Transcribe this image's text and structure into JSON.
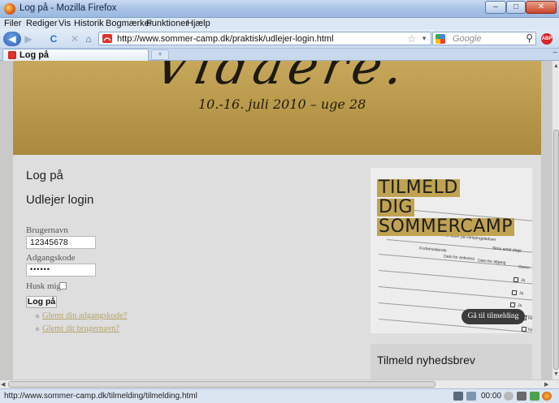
{
  "window": {
    "title": "Log på - Mozilla Firefox",
    "min_glyph": "–",
    "max_glyph": "□",
    "close_glyph": "✕"
  },
  "menu": [
    "Filer",
    "Rediger",
    "Vis",
    "Historik",
    "Bogmærker",
    "Funktioner",
    "Hjælp"
  ],
  "toolbar": {
    "back_glyph": "◀",
    "forward_glyph": "▶",
    "reload_glyph": "C",
    "stop_glyph": "✕",
    "home_glyph": "⌂",
    "url": "http://www.sommer-camp.dk/praktisk/udlejer-login.html",
    "bookmark_star_glyph": "☆",
    "dropdown_glyph": "▼",
    "search_placeholder": "Google",
    "search_glyph": "⚲"
  },
  "tabs": {
    "active_label": "Log på",
    "new_tab_glyph": "+",
    "list_glyph": "−"
  },
  "banner": {
    "script_text": "Vidaere.",
    "date_line": "10.-16. juli 2010 – uge 28"
  },
  "login": {
    "heading": "Log på",
    "subheading": "Udlejer login",
    "username_label": "Brugernavn",
    "username_value": "12345678",
    "password_label": "Adgangskode",
    "password_value": "••••••",
    "remember_label": "Husk mig",
    "submit_label": "Log på",
    "forgot_password": "Glemt din adgangskode?",
    "forgot_username": "Glemt dit brugernavn?"
  },
  "promo": {
    "line1": "TILMELD",
    "line2": "DIG",
    "line3": "SOMMERCAMP",
    "button": "Gå til tilmelding",
    "form_texts": [
      "Overnatter på campingpladsen",
      "Skriv antal dage",
      "Forbeholdende",
      "Dato for ankomst",
      "Dato for afgang",
      "Overn",
      "Ja",
      "Ja",
      "Ja",
      "Ne",
      "Ne"
    ]
  },
  "newsletter": {
    "title": "Tilmeld nyhedsbrev"
  },
  "statusbar": {
    "url": "http://www.sommer-camp.dk/tilmelding/tilmelding.html",
    "time": "00:00"
  },
  "colors": {
    "gold": "#c0a352",
    "link": "#b4a36a",
    "button_dark": "#3b3b3b"
  }
}
